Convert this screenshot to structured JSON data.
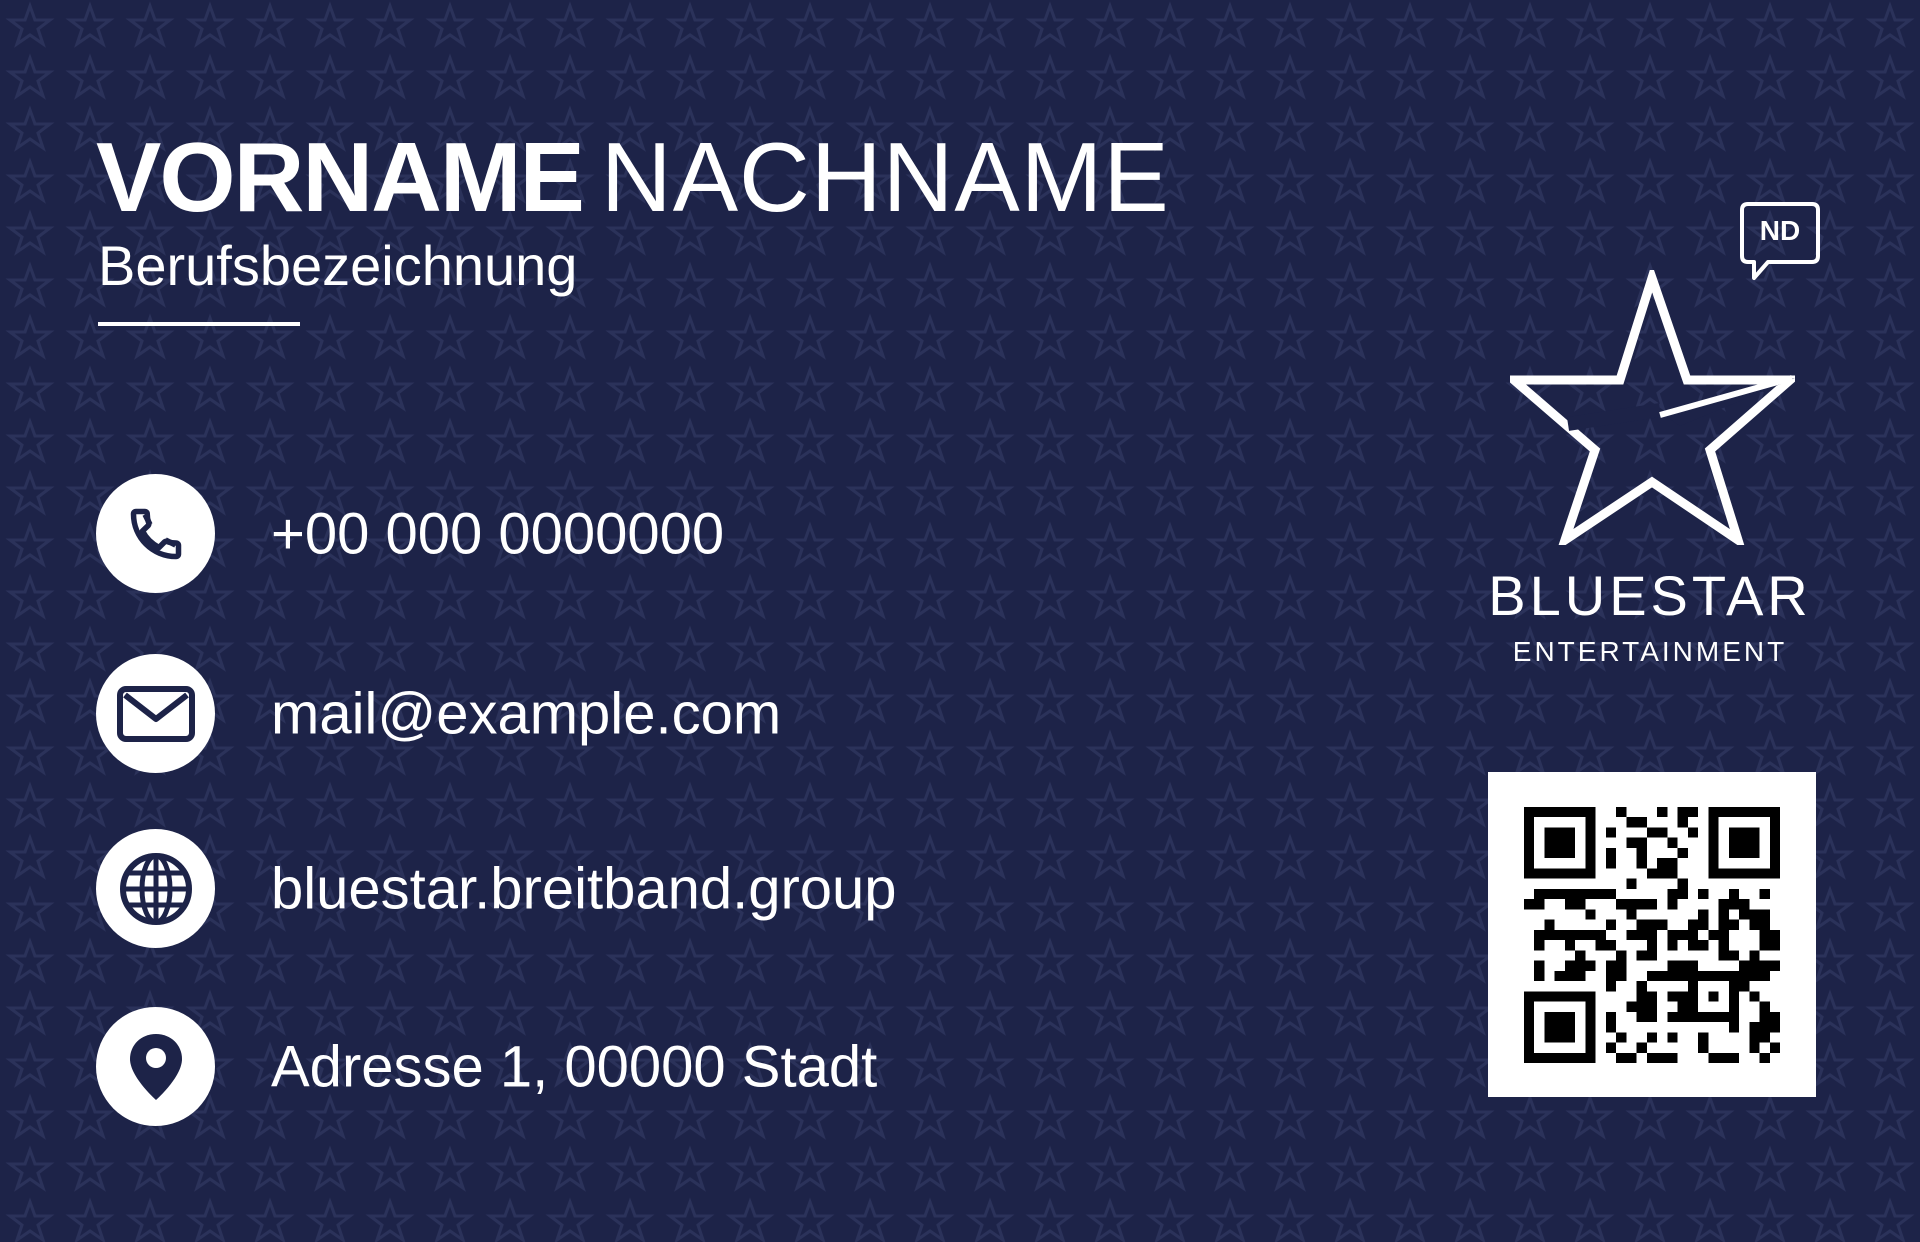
{
  "card": {
    "first_name": "VORNAME",
    "last_name": "NACHNAME",
    "job_title": "Berufsbezeichnung",
    "phone": "+00 000 0000000",
    "email": "mail@example.com",
    "website": "bluestar.breitband.group",
    "address": "Adresse 1, 00000 Stadt"
  },
  "brand": {
    "name": "BLUESTAR",
    "subtitle": "ENTERTAINMENT",
    "badge": "ND",
    "logo_icon": "star-outline-icon"
  },
  "icons": {
    "phone": "phone-icon",
    "email": "envelope-icon",
    "website": "globe-icon",
    "address": "location-pin-icon",
    "qr": "qr-code"
  },
  "colors": {
    "background": "#1d2348",
    "pattern_star": "#2a3159",
    "foreground": "#ffffff",
    "icon_fill": "#1d2348"
  }
}
